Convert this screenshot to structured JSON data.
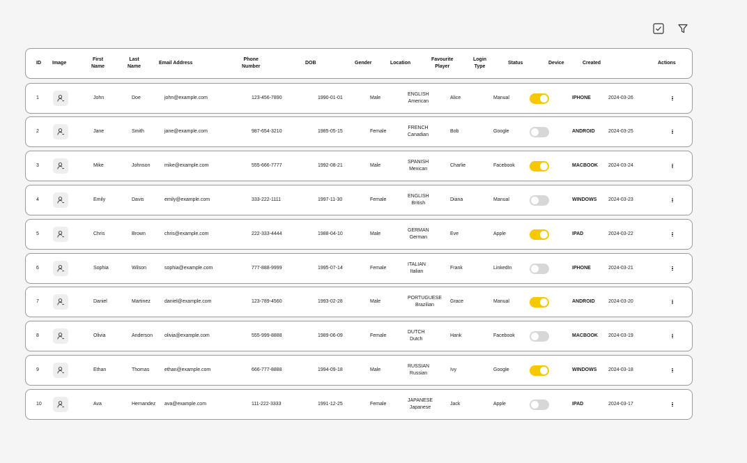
{
  "toolbar": {
    "select_icon": "checkbox-check-icon",
    "filter_icon": "filter-icon"
  },
  "colors": {
    "accent": "#f5c800",
    "toggle_off": "#d7d7d7",
    "row_border": "#9a9a9a"
  },
  "columns": {
    "id": "ID",
    "image": "Image",
    "first_name": [
      "First",
      "Name"
    ],
    "last_name": [
      "Last",
      "Name"
    ],
    "email": "Email Address",
    "phone": [
      "Phone",
      "Number"
    ],
    "dob": "DOB",
    "gender": "Gender",
    "location": "Location",
    "favourite_player": [
      "Favourite",
      "Player"
    ],
    "login_type": [
      "Login",
      "Type"
    ],
    "status": "Status",
    "device": "Device",
    "created": "Created",
    "actions": "Actions"
  },
  "rows": [
    {
      "id": "1",
      "first": "John",
      "last": "Doe",
      "email": "john@example.com",
      "phone": "123-456-7890",
      "dob": "1990-01-01",
      "gender": "Male",
      "loc1": "ENGLISH",
      "loc2": "American",
      "player": "Alice",
      "login": "Manual",
      "status_on": true,
      "device": "IPHONE",
      "created": "2024-03-26"
    },
    {
      "id": "2",
      "first": "Jane",
      "last": "Smith",
      "email": "jane@example.com",
      "phone": "987-654-3210",
      "dob": "1985-05-15",
      "gender": "Female",
      "loc1": "FRENCH",
      "loc2": "Canadian",
      "player": "Bob",
      "login": "Google",
      "status_on": false,
      "device": "ANDROID",
      "created": "2024-03-25"
    },
    {
      "id": "3",
      "first": "Mike",
      "last": "Johnson",
      "email": "mike@example.com",
      "phone": "555-666-7777",
      "dob": "1992-08-21",
      "gender": "Male",
      "loc1": "SPANISH",
      "loc2": "Mexican",
      "player": "Charlie",
      "login": "Facebook",
      "status_on": true,
      "device": "MACBOOK",
      "created": "2024-03-24"
    },
    {
      "id": "4",
      "first": "Emily",
      "last": "Davis",
      "email": "emily@example.com",
      "phone": "333-222-1111",
      "dob": "1997-11-30",
      "gender": "Female",
      "loc1": "ENGLISH",
      "loc2": "British",
      "player": "Diana",
      "login": "Manual",
      "status_on": false,
      "device": "WINDOWS",
      "created": "2024-03-23"
    },
    {
      "id": "5",
      "first": "Chris",
      "last": "Brown",
      "email": "chris@example.com",
      "phone": "222-333-4444",
      "dob": "1988-04-10",
      "gender": "Male",
      "loc1": "GERMAN",
      "loc2": "German",
      "player": "Eve",
      "login": "Apple",
      "status_on": true,
      "device": "IPAD",
      "created": "2024-03-22"
    },
    {
      "id": "6",
      "first": "Sophia",
      "last": "Wilson",
      "email": "sophia@example.com",
      "phone": "777-888-9999",
      "dob": "1995-07-14",
      "gender": "Female",
      "loc1": "ITALIAN",
      "loc2": "Italian",
      "player": "Frank",
      "login": "LinkedIn",
      "status_on": false,
      "device": "IPHONE",
      "created": "2024-03-21"
    },
    {
      "id": "7",
      "first": "Daniel",
      "last": "Martinez",
      "email": "daniel@example.com",
      "phone": "123-789-4560",
      "dob": "1993-02-28",
      "gender": "Male",
      "loc1": "PORTUGUESE",
      "loc2": "Brazilian",
      "player": "Grace",
      "login": "Manual",
      "status_on": true,
      "device": "ANDROID",
      "created": "2024-03-20"
    },
    {
      "id": "8",
      "first": "Olivia",
      "last": "Anderson",
      "email": "olivia@example.com",
      "phone": "555-999-8888",
      "dob": "1989-06-09",
      "gender": "Female",
      "loc1": "DUTCH",
      "loc2": "Dutch",
      "player": "Hank",
      "login": "Facebook",
      "status_on": false,
      "device": "MACBOOK",
      "created": "2024-03-19"
    },
    {
      "id": "9",
      "first": "Ethan",
      "last": "Thomas",
      "email": "ethan@example.com",
      "phone": "666-777-8888",
      "dob": "1994-09-18",
      "gender": "Male",
      "loc1": "RUSSIAN",
      "loc2": "Russian",
      "player": "Ivy",
      "login": "Google",
      "status_on": true,
      "device": "WINDOWS",
      "created": "2024-03-18"
    },
    {
      "id": "10",
      "first": "Ava",
      "last": "Hernandez",
      "email": "ava@example.com",
      "phone": "111-222-3333",
      "dob": "1991-12-25",
      "gender": "Female",
      "loc1": "JAPANESE",
      "loc2": "Japanese",
      "player": "Jack",
      "login": "Apple",
      "status_on": false,
      "device": "IPAD",
      "created": "2024-03-17"
    }
  ]
}
